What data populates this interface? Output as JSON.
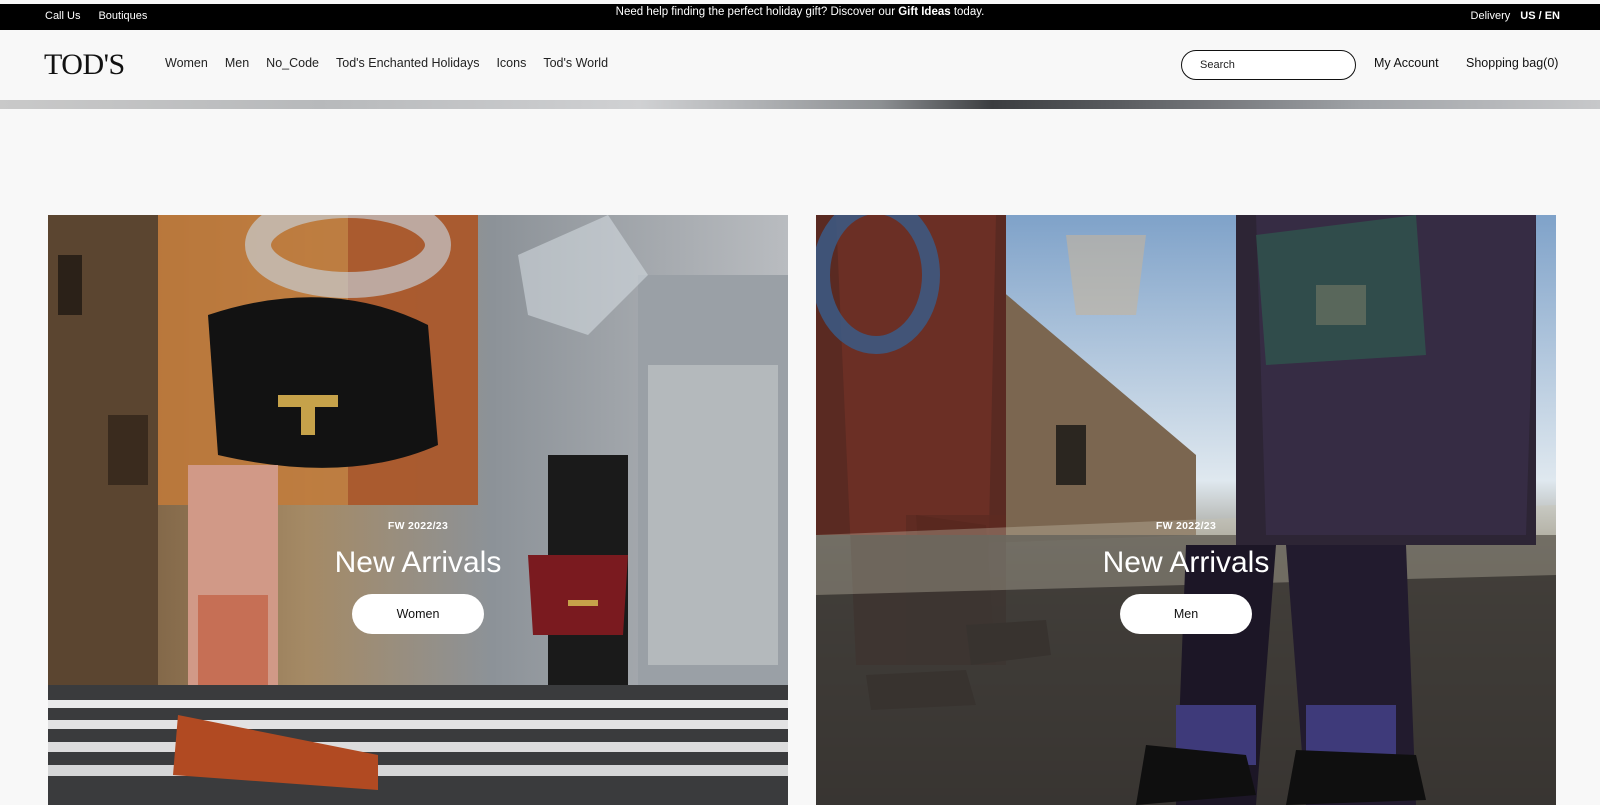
{
  "topbar": {
    "call_us": "Call Us",
    "boutiques": "Boutiques",
    "promo_prefix": "Need help finding the perfect holiday gift? Discover our ",
    "promo_link": "Gift Ideas",
    "promo_suffix": " today.",
    "delivery": "Delivery",
    "language": "US / EN"
  },
  "header": {
    "logo": "TOD'S",
    "nav": [
      "Women",
      "Men",
      "No_Code",
      "Tod's Enchanted Holidays",
      "Icons",
      "Tod's World"
    ],
    "search_placeholder": "Search",
    "account": "My Account",
    "bag": "Shopping bag(0)"
  },
  "cards": [
    {
      "season": "FW 2022/23",
      "title": "New Arrivals",
      "button": "Women"
    },
    {
      "season": "FW 2022/23",
      "title": "New Arrivals",
      "button": "Men"
    }
  ],
  "colors": {
    "topbar_bg": "#000000",
    "page_bg": "#f8f8f8",
    "button_bg": "#ffffff"
  }
}
